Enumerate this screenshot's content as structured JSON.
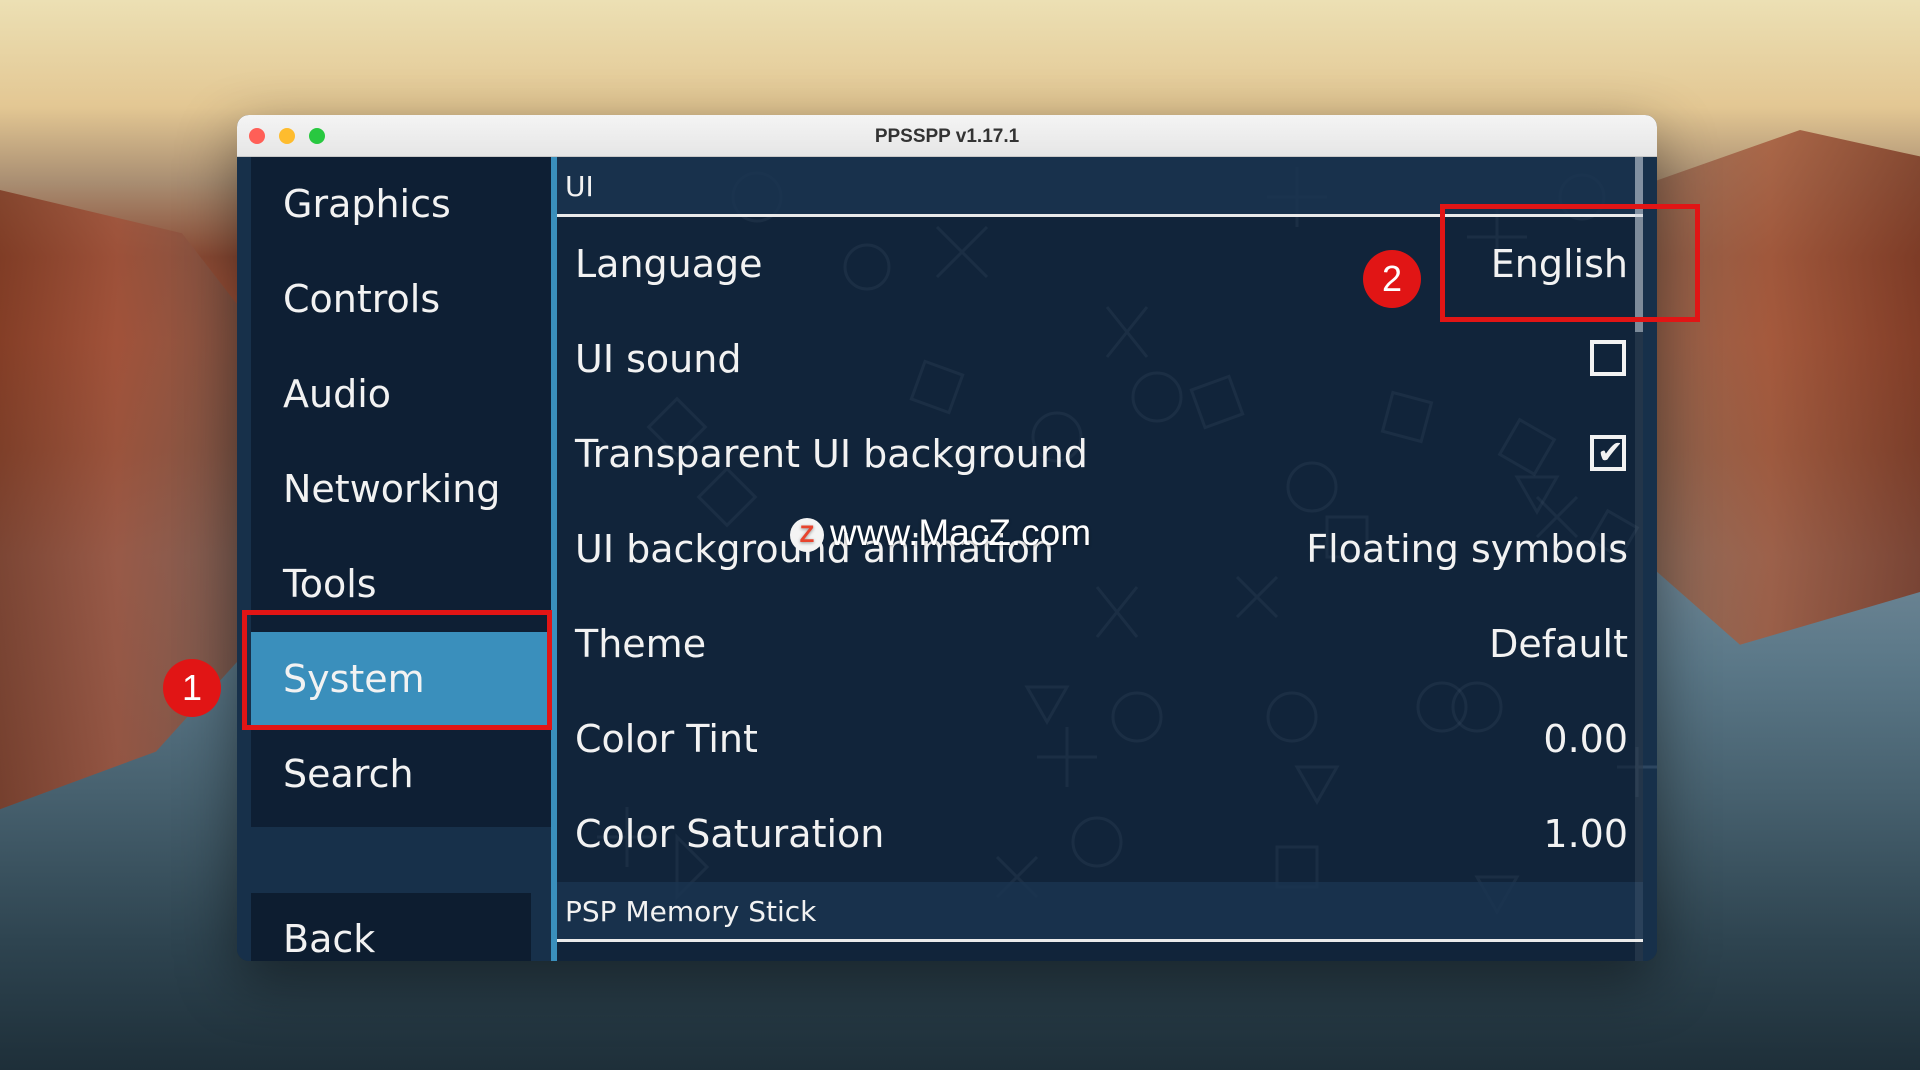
{
  "window": {
    "title": "PPSSPP v1.17.1"
  },
  "sidebar": {
    "items": [
      {
        "label": "Graphics"
      },
      {
        "label": "Controls"
      },
      {
        "label": "Audio"
      },
      {
        "label": "Networking"
      },
      {
        "label": "Tools"
      },
      {
        "label": "System",
        "selected": true
      },
      {
        "label": "Search"
      }
    ],
    "back_label": "Back"
  },
  "content": {
    "ui_section": {
      "header": "UI",
      "rows": [
        {
          "label": "Language",
          "value": "English"
        },
        {
          "label": "UI sound",
          "checked": false
        },
        {
          "label": "Transparent UI background",
          "checked": true
        },
        {
          "label": "UI background animation",
          "value": "Floating symbols"
        },
        {
          "label": "Theme",
          "value": "Default"
        },
        {
          "label": "Color Tint",
          "value": "0.00"
        },
        {
          "label": "Color Saturation",
          "value": "1.00"
        }
      ]
    },
    "memory_section": {
      "header": "PSP Memory Stick"
    }
  },
  "annotations": {
    "badge1": "1",
    "badge2": "2",
    "color": "#e11515"
  },
  "watermark": {
    "logo": "Z",
    "text": "www.MacZ.com"
  },
  "colors": {
    "accent": "#3a8fbc",
    "background": "#17304a"
  }
}
